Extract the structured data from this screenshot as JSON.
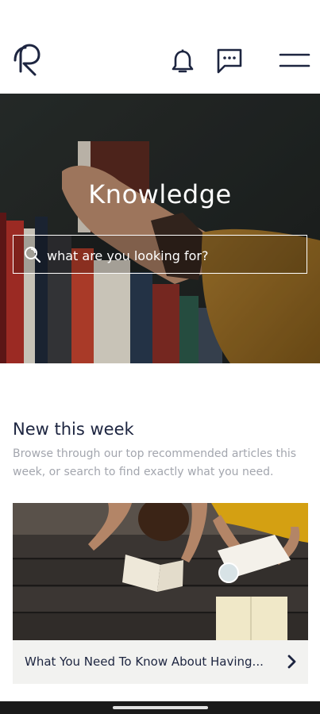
{
  "header": {
    "logo_icon": "brand-logo-icon",
    "icons": [
      "bell-icon",
      "chat-icon",
      "menu-icon"
    ]
  },
  "hero": {
    "title": "Knowledge",
    "search_placeholder": "what are you looking for?",
    "search_icon": "search-icon"
  },
  "section": {
    "title": "New this week",
    "description": "Browse through our top recommended articles this week, or search to find exactly what you need."
  },
  "card": {
    "title": "What You Need To Know About Having...",
    "chevron_icon": "chevron-right-icon"
  },
  "colors": {
    "navy": "#1d2540",
    "muted_text": "#a3a6ae",
    "card_footer": "#f2f2f0"
  }
}
